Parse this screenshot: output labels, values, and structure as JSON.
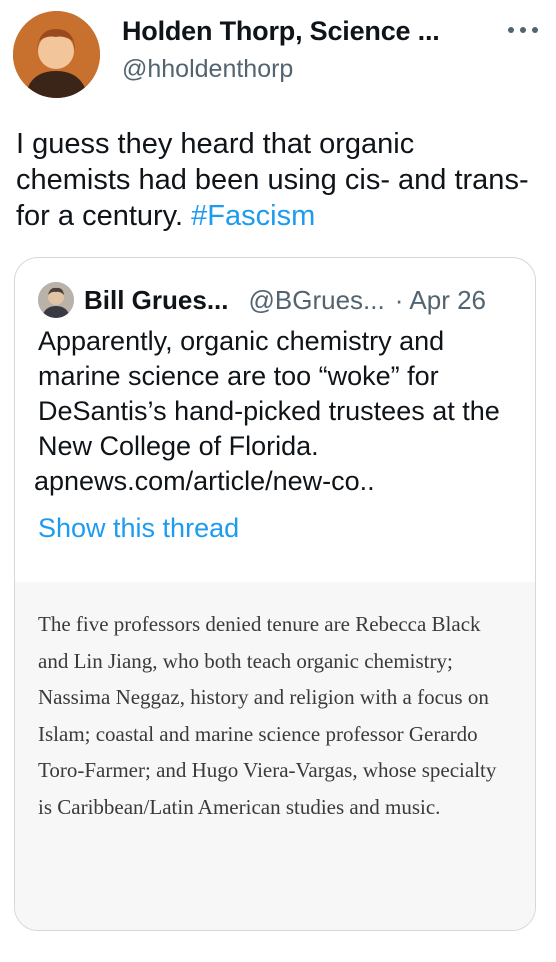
{
  "author": {
    "display_name": "Holden Thorp, Science ...",
    "handle": "@hholdenthorp"
  },
  "tweet": {
    "text": "I guess they heard that organic chemists had been using cis- and trans- for a century.",
    "hashtag": "#Fascism"
  },
  "quoted": {
    "display_name": "Bill Grues...",
    "handle": "@BGrues...",
    "separator": "·",
    "date": "Apr 26",
    "text": "Apparently, organic chemistry and marine science are too “woke” for DeSantis’s hand-picked trustees at the New College of Florida.",
    "link": "apnews.com/article/new-co..",
    "show_thread": "Show this thread",
    "image_text": "The five professors denied tenure are Rebecca Black and Lin Jiang, who both teach organic chemistry; Nassima Neggaz, history and religion with a focus on Islam; coastal and marine science professor Gerardo Toro-Farmer; and Hugo Viera-Vargas, whose specialty is Caribbean/Latin American studies and music."
  },
  "colors": {
    "link": "#1d9bf0",
    "secondary_text": "#536471",
    "border": "#cfd9de",
    "image_bg": "#f7f7f7"
  },
  "icons": {
    "more": "more-horizontal-icon"
  }
}
